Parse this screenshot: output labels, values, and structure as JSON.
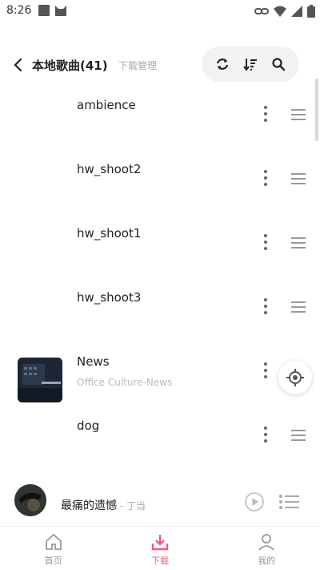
{
  "status_bar": {
    "time": "8:26"
  },
  "header": {
    "title": "本地歌曲(41)",
    "subtitle": "下载管理"
  },
  "songs": [
    {
      "title": "ambience",
      "subtitle": ""
    },
    {
      "title": "hw_shoot2",
      "subtitle": ""
    },
    {
      "title": "hw_shoot1",
      "subtitle": ""
    },
    {
      "title": "hw_shoot3",
      "subtitle": ""
    },
    {
      "title": "News",
      "subtitle": "Office Culture-News"
    },
    {
      "title": "dog",
      "subtitle": ""
    }
  ],
  "player": {
    "title": "最痛的遗憾",
    "artist": " - 丁当"
  },
  "nav": [
    {
      "label": "首页",
      "icon": "home-icon"
    },
    {
      "label": "下载",
      "icon": "download-icon",
      "active": true
    },
    {
      "label": "我的",
      "icon": "user-icon"
    }
  ],
  "colors": {
    "accent": "#f0597a",
    "icon_grey": "#999999",
    "toolbar_bg": "#f2f2f2"
  }
}
